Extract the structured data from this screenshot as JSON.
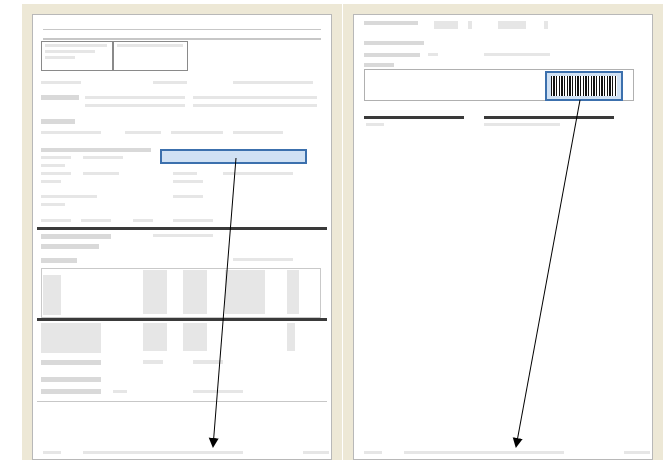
{
  "pages": [
    {
      "name": "page-1",
      "title": ""
    },
    {
      "name": "page-2",
      "title": ""
    }
  ],
  "colors": {
    "frame": "#ede8d6",
    "highlight_border": "#3c70ad",
    "highlight_fill": "#aac8eb",
    "arrow": "#000000",
    "page_border": "#b8b8b8"
  },
  "icons": [
    "barcode-icon",
    "arrow-icon"
  ]
}
